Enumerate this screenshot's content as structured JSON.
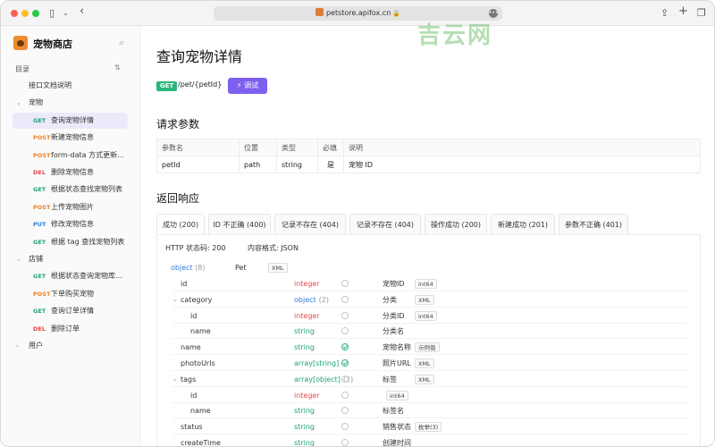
{
  "browser": {
    "url": "petstore.apifox.cn",
    "watermark": "吉云网",
    "lock_glyph": "🔒",
    "more_glyph": "•••"
  },
  "sidebar": {
    "app_name": "宠物商店",
    "toc_label": "目录",
    "items": [
      {
        "kind": "doc",
        "label": "接口文档说明"
      },
      {
        "kind": "folder",
        "label": "宠物",
        "caret": "⌄"
      },
      {
        "kind": "api",
        "method": "GET",
        "label": "查询宠物详情",
        "active": true
      },
      {
        "kind": "api",
        "method": "POST",
        "label": "新建宠物信息"
      },
      {
        "kind": "api",
        "method": "POST",
        "label": "form-data 方式更新..."
      },
      {
        "kind": "api",
        "method": "DEL",
        "label": "删除宠物信息"
      },
      {
        "kind": "api",
        "method": "GET",
        "label": "根据状态查找宠物列表"
      },
      {
        "kind": "api",
        "method": "POST",
        "label": "上传宠物图片"
      },
      {
        "kind": "api",
        "method": "PUT",
        "label": "修改宠物信息"
      },
      {
        "kind": "api",
        "method": "GET",
        "label": "根据 tag 查找宠物列表"
      },
      {
        "kind": "folder",
        "label": "店铺",
        "caret": "⌄"
      },
      {
        "kind": "api",
        "method": "GET",
        "label": "根据状态查询宠物库..."
      },
      {
        "kind": "api",
        "method": "POST",
        "label": "下单购买宠物"
      },
      {
        "kind": "api",
        "method": "GET",
        "label": "查询订单详情"
      },
      {
        "kind": "api",
        "method": "DEL",
        "label": "删除订单"
      },
      {
        "kind": "folder",
        "label": "用户",
        "caret": "›"
      }
    ]
  },
  "main": {
    "title": "查询宠物详情",
    "method": "GET",
    "path": "/pet/{petId}",
    "debug_label": "调试",
    "request_params_title": "请求参数",
    "params_headers": [
      "参数名",
      "位置",
      "类型",
      "必填",
      "说明"
    ],
    "params_rows": [
      [
        "petId",
        "path",
        "string",
        "是",
        "宠物 ID"
      ]
    ],
    "response_title": "返回响应",
    "tabs": [
      {
        "label": "成功 (200)",
        "active": true
      },
      {
        "label": "ID 不正确 (400)"
      },
      {
        "label": "记录不存在 (404)"
      },
      {
        "label": "记录不存在 (404)"
      },
      {
        "label": "操作成功 (200)"
      },
      {
        "label": "新建成功 (201)"
      },
      {
        "label": "参数不正确 (401)"
      }
    ],
    "status_code": "HTTP 状态码: 200",
    "content_type": "内容格式: JSON",
    "schema": {
      "root_type": "object",
      "root_count": "(8)",
      "root_name": "Pet",
      "root_tag": "XML",
      "fields": [
        {
          "name": "id",
          "type": "integer",
          "desc": "宠物ID",
          "tag": "int64",
          "required": false,
          "depth": 0
        },
        {
          "name": "category",
          "type": "object",
          "count": "(2)",
          "desc": "分类",
          "tag": "XML",
          "required": false,
          "depth": 0,
          "expandable": true
        },
        {
          "name": "id",
          "type": "integer",
          "desc": "分类ID",
          "tag": "int64",
          "required": false,
          "depth": 1
        },
        {
          "name": "name",
          "type": "string",
          "desc": "分类名",
          "tag": "",
          "required": false,
          "depth": 1
        },
        {
          "name": "name",
          "type": "string",
          "desc": "宠物名称",
          "tag": "示例值",
          "required": true,
          "depth": 0
        },
        {
          "name": "photoUrls",
          "type": "array[string]",
          "desc": "照片URL",
          "tag": "XML",
          "required": true,
          "depth": 0
        },
        {
          "name": "tags",
          "type": "array[object]",
          "count": "(2)",
          "desc": "标签",
          "tag": "XML",
          "required": false,
          "depth": 0,
          "expandable": true
        },
        {
          "name": "id",
          "type": "integer",
          "desc": "",
          "tag": "int64",
          "required": false,
          "depth": 1
        },
        {
          "name": "name",
          "type": "string",
          "desc": "标签名",
          "tag": "",
          "required": false,
          "depth": 1
        },
        {
          "name": "status",
          "type": "string",
          "desc": "销售状态",
          "tag": "枚举(3)",
          "required": false,
          "depth": 0
        },
        {
          "name": "createTime",
          "type": "string",
          "desc": "创建时间",
          "tag": "",
          "required": false,
          "depth": 0
        }
      ]
    }
  },
  "colors": {
    "get": "#1fa37a",
    "post": "#e8832a",
    "del": "#e5484d",
    "put": "#2f7fdd",
    "accent": "#7f5ff0"
  }
}
